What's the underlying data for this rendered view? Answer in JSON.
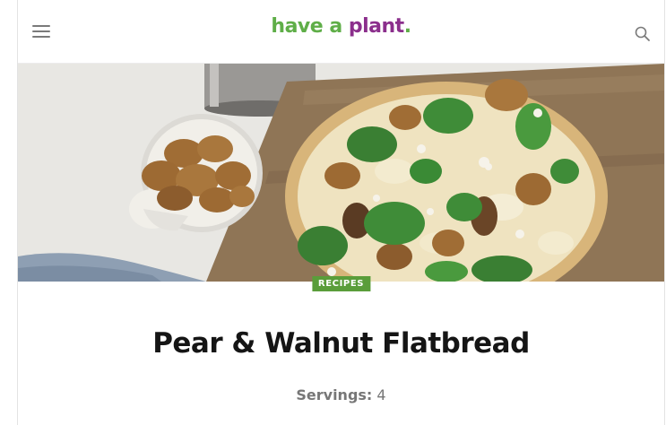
{
  "header": {
    "logo_word_1": "have a",
    "logo_word_2": "plant",
    "logo_dot": ".",
    "menu_icon": "hamburger-menu-icon",
    "search_icon": "search-icon"
  },
  "hero": {
    "image": "pear-walnut-flatbread-photo"
  },
  "article": {
    "category": "RECIPES",
    "title": "Pear & Walnut Flatbread",
    "servings_label": "Servings:",
    "servings_value": "4"
  },
  "colors": {
    "logo_green": "#5fae48",
    "logo_purple": "#8b2f8c",
    "badge_green": "#5a9d3a"
  }
}
